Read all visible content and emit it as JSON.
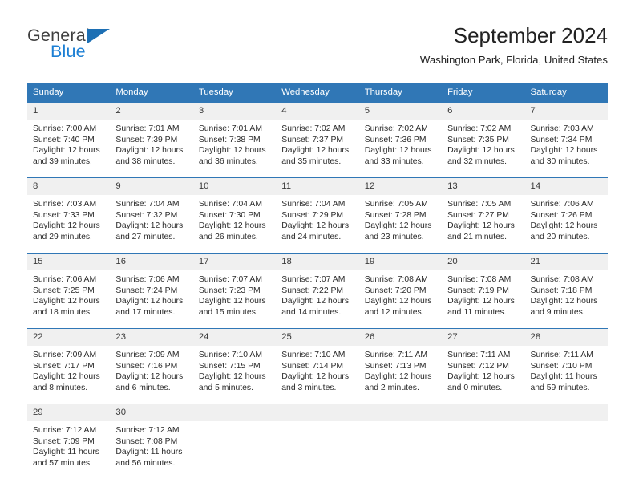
{
  "brand": {
    "name_top": "General",
    "name_bottom": "Blue",
    "triangle_color": "#1c6fb4",
    "top_color": "#3f3f3f",
    "bottom_color": "#1c7fd4"
  },
  "header": {
    "title": "September 2024",
    "subtitle": "Washington Park, Florida, United States",
    "accent_color": "#3077b6",
    "daynum_band_color": "#f0f0f0"
  },
  "labels": {
    "sunrise_prefix": "Sunrise:",
    "sunset_prefix": "Sunset:",
    "daylight_prefix": "Daylight:"
  },
  "weekdays": [
    "Sunday",
    "Monday",
    "Tuesday",
    "Wednesday",
    "Thursday",
    "Friday",
    "Saturday"
  ],
  "weeks": [
    [
      {
        "day": "1",
        "sunrise": "Sunrise: 7:00 AM",
        "sunset": "Sunset: 7:40 PM",
        "daylight1": "Daylight: 12 hours",
        "daylight2": "and 39 minutes."
      },
      {
        "day": "2",
        "sunrise": "Sunrise: 7:01 AM",
        "sunset": "Sunset: 7:39 PM",
        "daylight1": "Daylight: 12 hours",
        "daylight2": "and 38 minutes."
      },
      {
        "day": "3",
        "sunrise": "Sunrise: 7:01 AM",
        "sunset": "Sunset: 7:38 PM",
        "daylight1": "Daylight: 12 hours",
        "daylight2": "and 36 minutes."
      },
      {
        "day": "4",
        "sunrise": "Sunrise: 7:02 AM",
        "sunset": "Sunset: 7:37 PM",
        "daylight1": "Daylight: 12 hours",
        "daylight2": "and 35 minutes."
      },
      {
        "day": "5",
        "sunrise": "Sunrise: 7:02 AM",
        "sunset": "Sunset: 7:36 PM",
        "daylight1": "Daylight: 12 hours",
        "daylight2": "and 33 minutes."
      },
      {
        "day": "6",
        "sunrise": "Sunrise: 7:02 AM",
        "sunset": "Sunset: 7:35 PM",
        "daylight1": "Daylight: 12 hours",
        "daylight2": "and 32 minutes."
      },
      {
        "day": "7",
        "sunrise": "Sunrise: 7:03 AM",
        "sunset": "Sunset: 7:34 PM",
        "daylight1": "Daylight: 12 hours",
        "daylight2": "and 30 minutes."
      }
    ],
    [
      {
        "day": "8",
        "sunrise": "Sunrise: 7:03 AM",
        "sunset": "Sunset: 7:33 PM",
        "daylight1": "Daylight: 12 hours",
        "daylight2": "and 29 minutes."
      },
      {
        "day": "9",
        "sunrise": "Sunrise: 7:04 AM",
        "sunset": "Sunset: 7:32 PM",
        "daylight1": "Daylight: 12 hours",
        "daylight2": "and 27 minutes."
      },
      {
        "day": "10",
        "sunrise": "Sunrise: 7:04 AM",
        "sunset": "Sunset: 7:30 PM",
        "daylight1": "Daylight: 12 hours",
        "daylight2": "and 26 minutes."
      },
      {
        "day": "11",
        "sunrise": "Sunrise: 7:04 AM",
        "sunset": "Sunset: 7:29 PM",
        "daylight1": "Daylight: 12 hours",
        "daylight2": "and 24 minutes."
      },
      {
        "day": "12",
        "sunrise": "Sunrise: 7:05 AM",
        "sunset": "Sunset: 7:28 PM",
        "daylight1": "Daylight: 12 hours",
        "daylight2": "and 23 minutes."
      },
      {
        "day": "13",
        "sunrise": "Sunrise: 7:05 AM",
        "sunset": "Sunset: 7:27 PM",
        "daylight1": "Daylight: 12 hours",
        "daylight2": "and 21 minutes."
      },
      {
        "day": "14",
        "sunrise": "Sunrise: 7:06 AM",
        "sunset": "Sunset: 7:26 PM",
        "daylight1": "Daylight: 12 hours",
        "daylight2": "and 20 minutes."
      }
    ],
    [
      {
        "day": "15",
        "sunrise": "Sunrise: 7:06 AM",
        "sunset": "Sunset: 7:25 PM",
        "daylight1": "Daylight: 12 hours",
        "daylight2": "and 18 minutes."
      },
      {
        "day": "16",
        "sunrise": "Sunrise: 7:06 AM",
        "sunset": "Sunset: 7:24 PM",
        "daylight1": "Daylight: 12 hours",
        "daylight2": "and 17 minutes."
      },
      {
        "day": "17",
        "sunrise": "Sunrise: 7:07 AM",
        "sunset": "Sunset: 7:23 PM",
        "daylight1": "Daylight: 12 hours",
        "daylight2": "and 15 minutes."
      },
      {
        "day": "18",
        "sunrise": "Sunrise: 7:07 AM",
        "sunset": "Sunset: 7:22 PM",
        "daylight1": "Daylight: 12 hours",
        "daylight2": "and 14 minutes."
      },
      {
        "day": "19",
        "sunrise": "Sunrise: 7:08 AM",
        "sunset": "Sunset: 7:20 PM",
        "daylight1": "Daylight: 12 hours",
        "daylight2": "and 12 minutes."
      },
      {
        "day": "20",
        "sunrise": "Sunrise: 7:08 AM",
        "sunset": "Sunset: 7:19 PM",
        "daylight1": "Daylight: 12 hours",
        "daylight2": "and 11 minutes."
      },
      {
        "day": "21",
        "sunrise": "Sunrise: 7:08 AM",
        "sunset": "Sunset: 7:18 PM",
        "daylight1": "Daylight: 12 hours",
        "daylight2": "and 9 minutes."
      }
    ],
    [
      {
        "day": "22",
        "sunrise": "Sunrise: 7:09 AM",
        "sunset": "Sunset: 7:17 PM",
        "daylight1": "Daylight: 12 hours",
        "daylight2": "and 8 minutes."
      },
      {
        "day": "23",
        "sunrise": "Sunrise: 7:09 AM",
        "sunset": "Sunset: 7:16 PM",
        "daylight1": "Daylight: 12 hours",
        "daylight2": "and 6 minutes."
      },
      {
        "day": "24",
        "sunrise": "Sunrise: 7:10 AM",
        "sunset": "Sunset: 7:15 PM",
        "daylight1": "Daylight: 12 hours",
        "daylight2": "and 5 minutes."
      },
      {
        "day": "25",
        "sunrise": "Sunrise: 7:10 AM",
        "sunset": "Sunset: 7:14 PM",
        "daylight1": "Daylight: 12 hours",
        "daylight2": "and 3 minutes."
      },
      {
        "day": "26",
        "sunrise": "Sunrise: 7:11 AM",
        "sunset": "Sunset: 7:13 PM",
        "daylight1": "Daylight: 12 hours",
        "daylight2": "and 2 minutes."
      },
      {
        "day": "27",
        "sunrise": "Sunrise: 7:11 AM",
        "sunset": "Sunset: 7:12 PM",
        "daylight1": "Daylight: 12 hours",
        "daylight2": "and 0 minutes."
      },
      {
        "day": "28",
        "sunrise": "Sunrise: 7:11 AM",
        "sunset": "Sunset: 7:10 PM",
        "daylight1": "Daylight: 11 hours",
        "daylight2": "and 59 minutes."
      }
    ],
    [
      {
        "day": "29",
        "sunrise": "Sunrise: 7:12 AM",
        "sunset": "Sunset: 7:09 PM",
        "daylight1": "Daylight: 11 hours",
        "daylight2": "and 57 minutes."
      },
      {
        "day": "30",
        "sunrise": "Sunrise: 7:12 AM",
        "sunset": "Sunset: 7:08 PM",
        "daylight1": "Daylight: 11 hours",
        "daylight2": "and 56 minutes."
      },
      {
        "day": "",
        "sunrise": "",
        "sunset": "",
        "daylight1": "",
        "daylight2": ""
      },
      {
        "day": "",
        "sunrise": "",
        "sunset": "",
        "daylight1": "",
        "daylight2": ""
      },
      {
        "day": "",
        "sunrise": "",
        "sunset": "",
        "daylight1": "",
        "daylight2": ""
      },
      {
        "day": "",
        "sunrise": "",
        "sunset": "",
        "daylight1": "",
        "daylight2": ""
      },
      {
        "day": "",
        "sunrise": "",
        "sunset": "",
        "daylight1": "",
        "daylight2": ""
      }
    ]
  ]
}
